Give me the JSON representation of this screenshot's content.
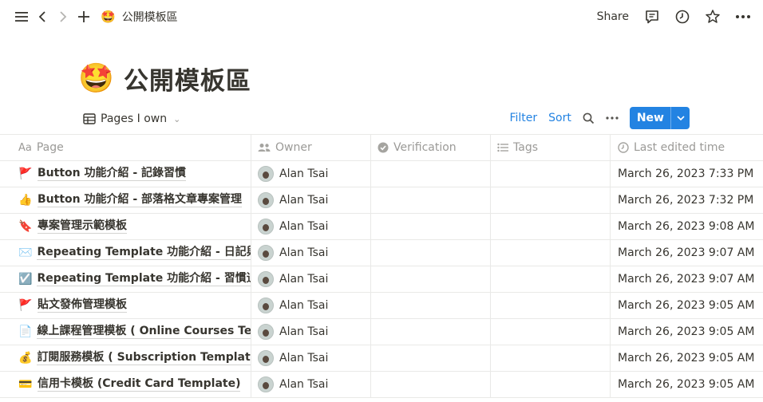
{
  "topbar": {
    "breadcrumb_emoji": "🤩",
    "breadcrumb_title": "公開模板區",
    "share_label": "Share"
  },
  "page": {
    "emoji": "🤩",
    "title": "公開模板區"
  },
  "view": {
    "name": "Pages I own",
    "filter_label": "Filter",
    "sort_label": "Sort",
    "new_label": "New"
  },
  "columns": {
    "page": "Page",
    "owner": "Owner",
    "verification": "Verification",
    "tags": "Tags",
    "last_edited": "Last edited time"
  },
  "rows": [
    {
      "emoji": "🚩",
      "title": "Button 功能介紹 - 記錄習慣",
      "owner": "Alan Tsai",
      "time": "March 26, 2023 7:33 PM"
    },
    {
      "emoji": "👍",
      "title": "Button 功能介紹 - 部落格文章專案管理",
      "owner": "Alan Tsai",
      "time": "March 26, 2023 7:32 PM"
    },
    {
      "emoji": "🔖",
      "title": "專案管理示範模板",
      "owner": "Alan Tsai",
      "time": "March 26, 2023 9:08 AM"
    },
    {
      "emoji": "✉️",
      "title": "Repeating Template 功能介紹 - 日記與覆盤",
      "owner": "Alan Tsai",
      "time": "March 26, 2023 9:07 AM"
    },
    {
      "emoji": "☑️",
      "title": "Repeating Template 功能介紹 - 習慣追蹤（",
      "owner": "Alan Tsai",
      "time": "March 26, 2023 9:07 AM"
    },
    {
      "emoji": "🚩",
      "title": "貼文發佈管理模板",
      "owner": "Alan Tsai",
      "time": "March 26, 2023 9:05 AM"
    },
    {
      "emoji": "📄",
      "title": "線上課程管理模板 ( Online Courses Template )",
      "owner": "Alan Tsai",
      "time": "March 26, 2023 9:05 AM"
    },
    {
      "emoji": "💰",
      "title": "訂閱服務模板 ( Subscription Template )",
      "owner": "Alan Tsai",
      "time": "March 26, 2023 9:05 AM"
    },
    {
      "emoji": "💳",
      "title": "信用卡模板 (Credit Card Template)",
      "owner": "Alan Tsai",
      "time": "March 26, 2023 9:05 AM"
    }
  ],
  "colors": {
    "accent": "#2383e2",
    "text": "#37352f",
    "muted": "#9b9a97",
    "border": "#e9e9e7"
  }
}
